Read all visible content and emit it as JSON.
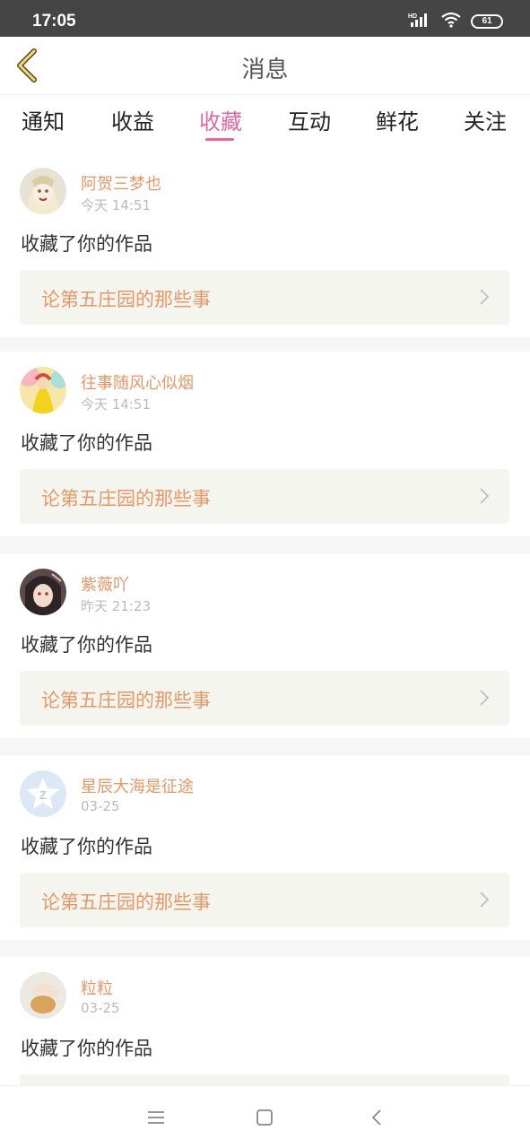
{
  "status_bar": {
    "time": "17:05",
    "battery": "61"
  },
  "header": {
    "title": "消息"
  },
  "tabs": [
    {
      "label": "通知"
    },
    {
      "label": "收益"
    },
    {
      "label": "收藏"
    },
    {
      "label": "互动"
    },
    {
      "label": "鲜花"
    },
    {
      "label": "关注"
    }
  ],
  "active_tab": "收藏",
  "colors": {
    "accent": "#e06a9f",
    "name_orange": "#e59766",
    "box_bg": "#f5f5ef"
  },
  "messages": [
    {
      "username": "阿贺三梦也",
      "time": "今天 14:51",
      "action": "收藏了你的作品",
      "work": "论第五庄园的那些事",
      "avatar": "avatar-photo"
    },
    {
      "username": "往事随风心似烟",
      "time": "今天 14:51",
      "action": "收藏了你的作品",
      "work": "论第五庄园的那些事",
      "avatar": "avatar-photo"
    },
    {
      "username": "紫薇吖",
      "time": "昨天 21:23",
      "action": "收藏了你的作品",
      "work": "论第五庄园的那些事",
      "avatar": "avatar-photo"
    },
    {
      "username": "星辰大海是征途",
      "time": "03-25",
      "action": "收藏了你的作品",
      "work": "论第五庄园的那些事",
      "avatar": "qzone-icon"
    },
    {
      "username": "粒粒",
      "time": "03-25",
      "action": "收藏了你的作品",
      "work": "",
      "avatar": "avatar-photo"
    }
  ]
}
